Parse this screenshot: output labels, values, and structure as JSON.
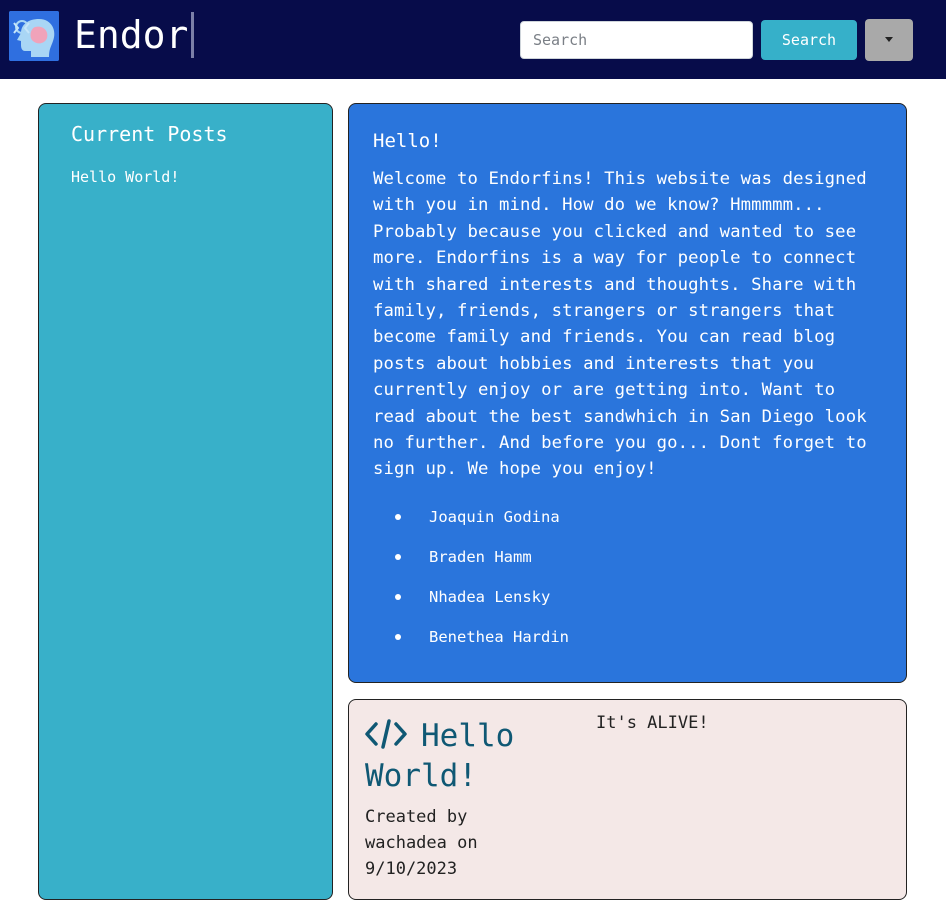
{
  "navbar": {
    "brand": "Endor",
    "search_placeholder": "Search",
    "search_button": "Search"
  },
  "sidebar": {
    "title": "Current Posts",
    "posts": [
      "Hello World!"
    ]
  },
  "welcome": {
    "title": "Hello!",
    "text": "Welcome to Endorfins! This website was designed with you in mind. How do we know? Hmmmmm... Probably because you clicked and wanted to see more. Endorfins is a way for people to connect with shared interests and thoughts. Share with family, friends, strangers or strangers that become family and friends. You can read blog posts about hobbies and interests that you currently enjoy or are getting into. Want to read about the best sandwhich in San Diego look no further. And before you go... Dont forget to sign up. We hope you enjoy!",
    "team": [
      "Joaquin Godina",
      "Braden Hamm",
      "Nhadea Lensky",
      "Benethea Hardin"
    ]
  },
  "post": {
    "title": "Hello World!",
    "meta": "Created by wachadea on 9/10/2023",
    "body": "It's ALIVE!",
    "icon": "code-icon"
  },
  "colors": {
    "navbar": "#070c4a",
    "sidebar": "#38b0c9",
    "welcome": "#2a75dc",
    "post": "#f4e8e7",
    "accent": "#36b0c9"
  }
}
